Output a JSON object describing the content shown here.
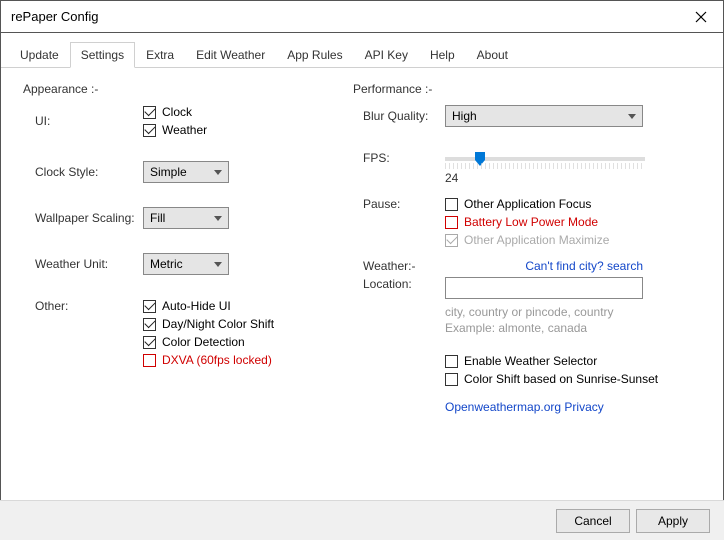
{
  "window": {
    "title": "rePaper Config"
  },
  "tabs": [
    "Update",
    "Settings",
    "Extra",
    "Edit Weather",
    "App Rules",
    "API Key",
    "Help",
    "About"
  ],
  "activeTab": "Settings",
  "left": {
    "section": "Appearance :-",
    "ui_label": "UI:",
    "ui_clock": "Clock",
    "ui_weather": "Weather",
    "clockstyle_label": "Clock Style:",
    "clockstyle_value": "Simple",
    "scaling_label": "Wallpaper Scaling:",
    "scaling_value": "Fill",
    "unit_label": "Weather Unit:",
    "unit_value": "Metric",
    "other_label": "Other:",
    "auto_hide": "Auto-Hide UI",
    "daynight": "Day/Night Color Shift",
    "color_detect": "Color Detection",
    "dxva": "DXVA (60fps locked)"
  },
  "right": {
    "section": "Performance :-",
    "blur_label": "Blur Quality:",
    "blur_value": "High",
    "fps_label": "FPS:",
    "fps_value": "24",
    "pause_label": "Pause:",
    "pause_focus": "Other Application Focus",
    "pause_battery": "Battery Low Power Mode",
    "pause_max": "Other Application Maximize",
    "weather_label": "Weather:-",
    "location_label": "Location:",
    "find_city": "Can't find city? search",
    "location_value": "",
    "hint1": "city, country or pincode, country",
    "hint2": "Example: almonte, canada",
    "enable_selector": "Enable Weather Selector",
    "color_shift": "Color Shift based on Sunrise-Sunset",
    "owm_link": "Openweathermap.org Privacy"
  },
  "footer": {
    "cancel": "Cancel",
    "apply": "Apply"
  }
}
